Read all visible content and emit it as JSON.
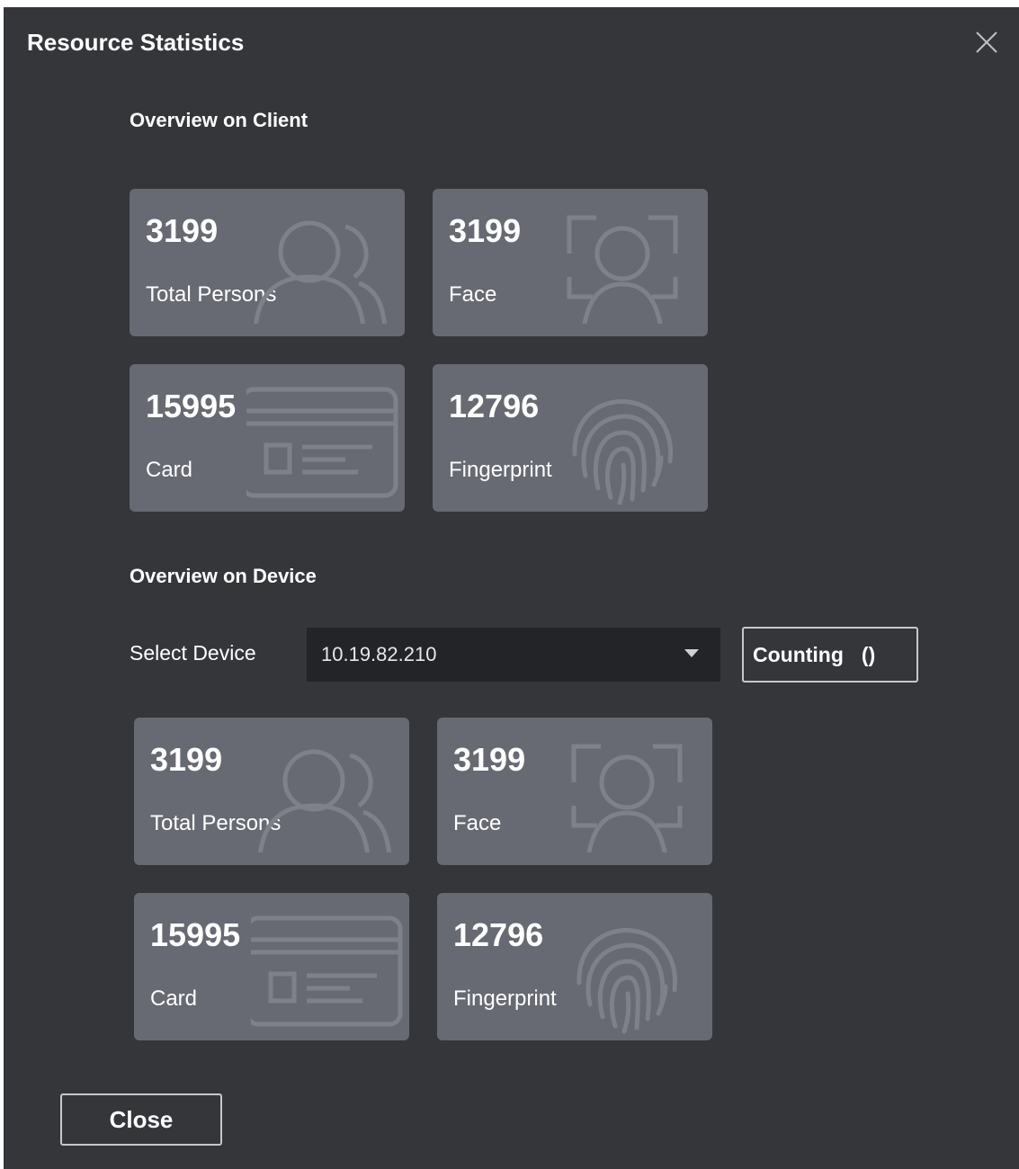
{
  "dialog": {
    "title": "Resource Statistics"
  },
  "client": {
    "heading": "Overview on Client",
    "stats": [
      {
        "value": "3199",
        "label": "Total Persons",
        "icon": "persons-icon"
      },
      {
        "value": "3199",
        "label": "Face",
        "icon": "face-scan-icon"
      },
      {
        "value": "15995",
        "label": "Card",
        "icon": "id-card-icon"
      },
      {
        "value": "12796",
        "label": "Fingerprint",
        "icon": "fingerprint-icon"
      }
    ]
  },
  "device": {
    "heading": "Overview on Device",
    "select_label": "Select Device",
    "selected_device": "10.19.82.210",
    "counting_label": "Counting",
    "counting_suffix": "()",
    "stats": [
      {
        "value": "3199",
        "label": "Total Persons",
        "icon": "persons-icon"
      },
      {
        "value": "3199",
        "label": "Face",
        "icon": "face-scan-icon"
      },
      {
        "value": "15995",
        "label": "Card",
        "icon": "id-card-icon"
      },
      {
        "value": "12796",
        "label": "Fingerprint",
        "icon": "fingerprint-icon"
      }
    ]
  },
  "footer": {
    "close_label": "Close"
  },
  "colors": {
    "dialog_bg": "#34363a",
    "card_bg": "#676a72",
    "select_bg": "#232428",
    "icon_stroke": "#7e8189"
  }
}
